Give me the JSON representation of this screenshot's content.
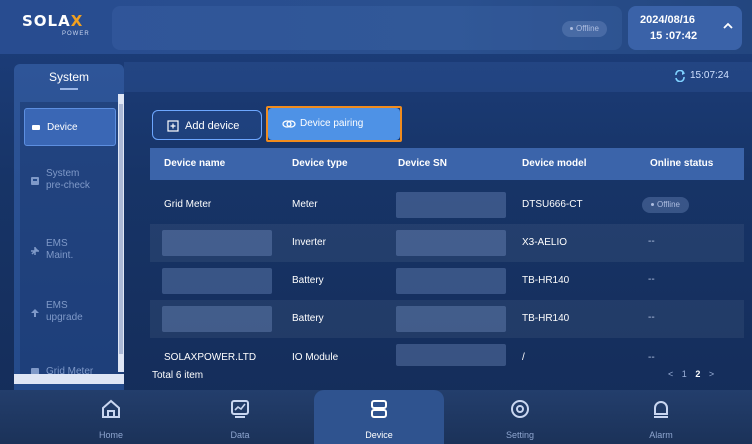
{
  "brand": {
    "name_a": "SOLA",
    "name_b": "X",
    "sub": "POWER"
  },
  "header": {
    "status": "Offline",
    "date": "2024/08/16",
    "time": "15 :07:42"
  },
  "subbar": {
    "time": "15:07:24"
  },
  "sidebar": {
    "title": "System",
    "items": [
      {
        "label": "Device",
        "icon": "device-icon"
      },
      {
        "label": "System\npre-check",
        "icon": "precheck-icon"
      },
      {
        "label": "EMS\nMaint.",
        "icon": "wrench-icon"
      },
      {
        "label": "EMS\nupgrade",
        "icon": "upgrade-icon"
      },
      {
        "label": "Grid Meter",
        "icon": "meter-icon"
      }
    ]
  },
  "toolbar": {
    "add_label": "Add device",
    "pair_label": "Device pairing"
  },
  "table": {
    "headers": [
      "Device name",
      "Device type",
      "Device SN",
      "Device model",
      "Online status"
    ],
    "rows": [
      {
        "name": "Grid Meter",
        "type": "Meter",
        "model": "DTSU666-CT",
        "status": "Offline"
      },
      {
        "name": "",
        "type": "Inverter",
        "model": "X3-AELIO",
        "status": "--"
      },
      {
        "name": "",
        "type": "Battery",
        "model": "TB-HR140",
        "status": "--"
      },
      {
        "name": "",
        "type": "Battery",
        "model": "TB-HR140",
        "status": "--"
      },
      {
        "name": "SOLAXPOWER.LTD",
        "type": "IO Module",
        "model": "/",
        "status": "--"
      }
    ]
  },
  "footer": {
    "total": "Total 6 item",
    "prev": "<",
    "page_a": "1",
    "page_b": "2",
    "next": ">"
  },
  "nav": [
    {
      "label": "Home",
      "icon": "home-icon"
    },
    {
      "label": "Data",
      "icon": "chart-icon"
    },
    {
      "label": "Device",
      "icon": "device-stack-icon"
    },
    {
      "label": "Setting",
      "icon": "settings-icon"
    },
    {
      "label": "Alarm",
      "icon": "alarm-icon"
    }
  ],
  "colors": {
    "accent": "#4e92e6",
    "highlight": "#f08c1e",
    "background": "#173467"
  }
}
